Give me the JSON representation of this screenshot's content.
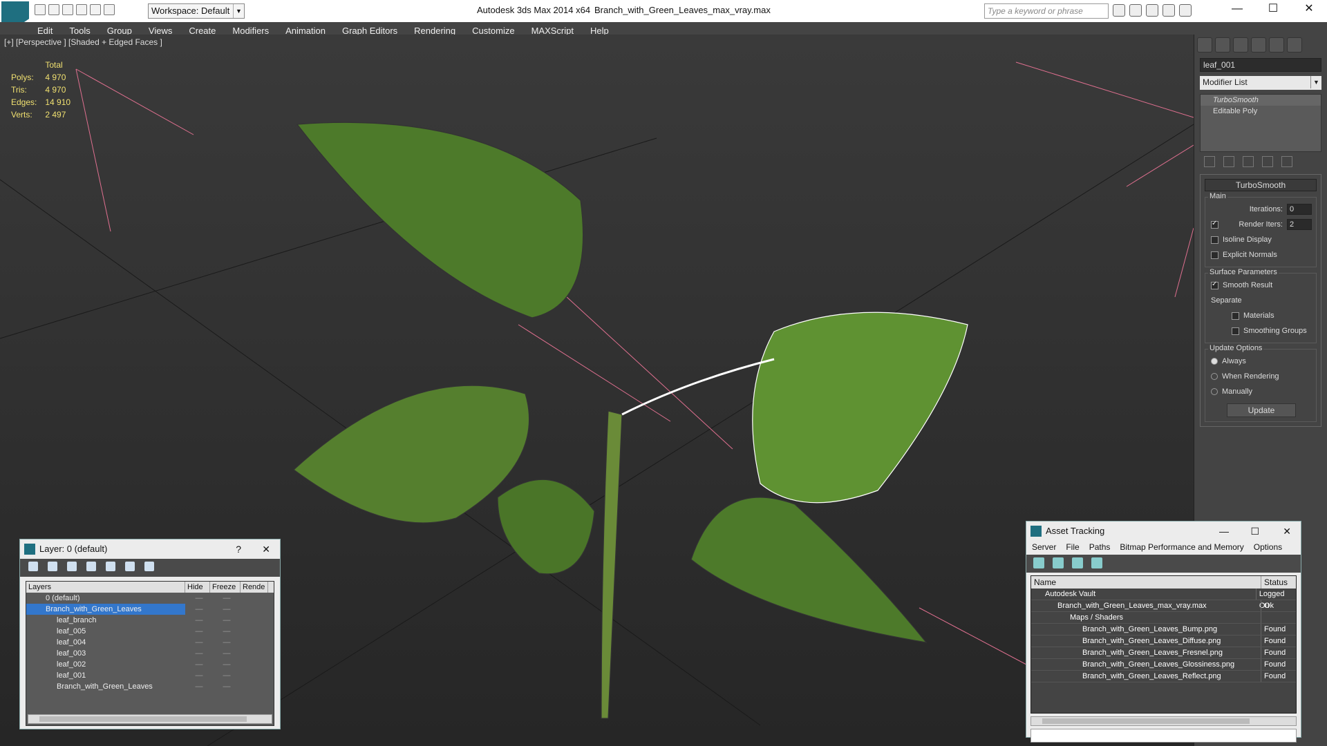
{
  "app": {
    "title": "Autodesk 3ds Max 2014 x64",
    "file": "Branch_with_Green_Leaves_max_vray.max",
    "workspace": "Workspace: Default",
    "search_placeholder": "Type a keyword or phrase"
  },
  "menu": [
    "Edit",
    "Tools",
    "Group",
    "Views",
    "Create",
    "Modifiers",
    "Animation",
    "Graph Editors",
    "Rendering",
    "Customize",
    "MAXScript",
    "Help"
  ],
  "viewport": {
    "label": "[+] [Perspective ] [Shaded + Edged Faces ]",
    "stats": {
      "header": "Total",
      "rows": [
        {
          "k": "Polys:",
          "v": "4 970"
        },
        {
          "k": "Tris:",
          "v": "4 970"
        },
        {
          "k": "Edges:",
          "v": "14 910"
        },
        {
          "k": "Verts:",
          "v": "2 497"
        }
      ]
    }
  },
  "cmd": {
    "object_name": "leaf_001",
    "modifier_list": "Modifier List",
    "stack": [
      "TurboSmooth",
      "Editable Poly"
    ],
    "turbosmooth": {
      "title": "TurboSmooth",
      "main": "Main",
      "iterations_label": "Iterations:",
      "iterations": "0",
      "render_iters_label": "Render Iters:",
      "render_iters": "2",
      "isoline": "Isoline Display",
      "explicit": "Explicit Normals",
      "surface": "Surface Parameters",
      "smooth_result": "Smooth Result",
      "separate": "Separate",
      "materials": "Materials",
      "smoothing_groups": "Smoothing Groups",
      "update_options": "Update Options",
      "always": "Always",
      "when_rendering": "When Rendering",
      "manually": "Manually",
      "update": "Update"
    }
  },
  "layer_dialog": {
    "title": "Layer: 0 (default)",
    "help": "?",
    "cols": [
      "Layers",
      "Hide",
      "Freeze",
      "Rende"
    ],
    "rows": [
      "0 (default)",
      "Branch_with_Green_Leaves",
      "leaf_branch",
      "leaf_005",
      "leaf_004",
      "leaf_003",
      "leaf_002",
      "leaf_001",
      "Branch_with_Green_Leaves"
    ]
  },
  "asset_dialog": {
    "title": "Asset Tracking",
    "menu": [
      "Server",
      "File",
      "Paths",
      "Bitmap Performance and Memory",
      "Options"
    ],
    "cols": [
      "Name",
      "Status"
    ],
    "rows": [
      {
        "n": "Autodesk Vault",
        "s": "Logged Ou"
      },
      {
        "n": "Branch_with_Green_Leaves_max_vray.max",
        "s": "Ok"
      },
      {
        "n": "Maps / Shaders",
        "s": ""
      },
      {
        "n": "Branch_with_Green_Leaves_Bump.png",
        "s": "Found"
      },
      {
        "n": "Branch_with_Green_Leaves_Diffuse.png",
        "s": "Found"
      },
      {
        "n": "Branch_with_Green_Leaves_Fresnel.png",
        "s": "Found"
      },
      {
        "n": "Branch_with_Green_Leaves_Glossiness.png",
        "s": "Found"
      },
      {
        "n": "Branch_with_Green_Leaves_Reflect.png",
        "s": "Found"
      }
    ]
  }
}
